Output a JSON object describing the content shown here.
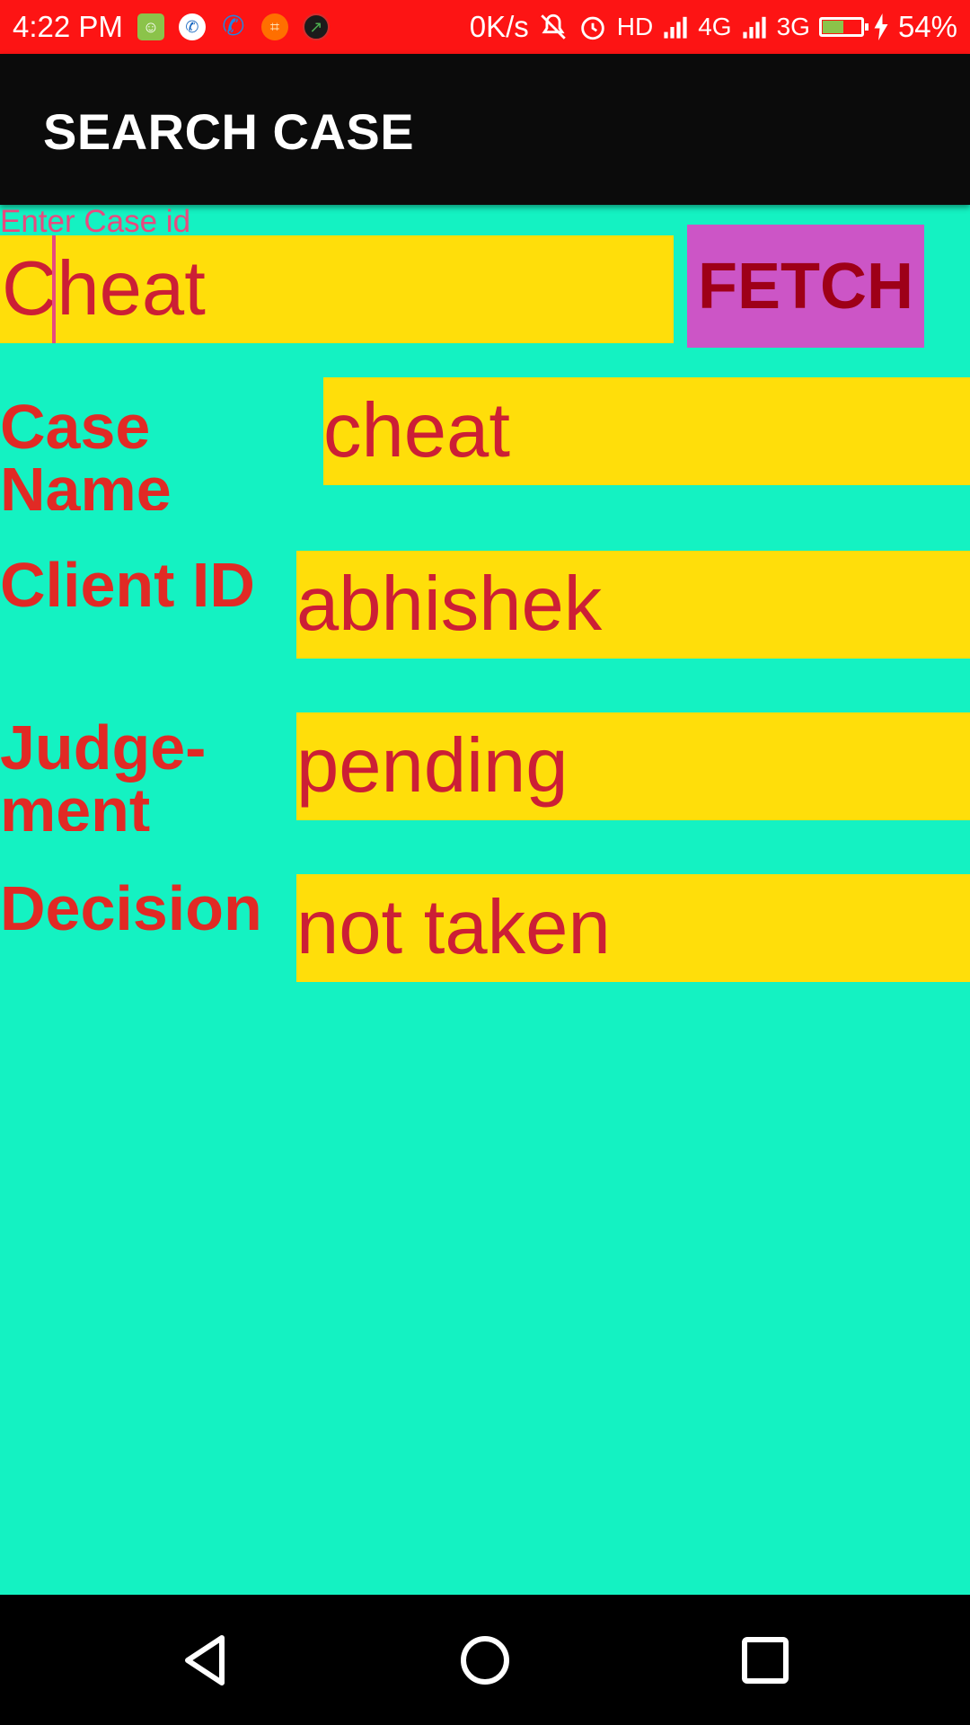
{
  "status_bar": {
    "time": "4:22 PM",
    "net_speed": "0K/s",
    "hd": "HD",
    "net1": "4G",
    "net2": "3G",
    "battery_pct": "54%",
    "battery_level": 0.54,
    "icons": [
      "message-icon",
      "call-icon",
      "phone-icon",
      "screenshot-icon",
      "recorder-icon",
      "mute-icon",
      "alarm-icon",
      "signal-icon",
      "charging-icon"
    ]
  },
  "app_bar": {
    "title": "SEARCH CASE"
  },
  "search": {
    "label": "Enter Case id",
    "value": "Cheat",
    "fetch_label": "FETCH"
  },
  "fields": [
    {
      "label": "Case Name",
      "value": "cheat"
    },
    {
      "label": "Client ID",
      "value": "abhishek"
    },
    {
      "label": "Judge-ment",
      "value": "pending"
    },
    {
      "label": "Decision",
      "value": "not taken"
    }
  ],
  "colors": {
    "background": "#14f2c2",
    "status_bar": "#fd1414",
    "app_bar": "#0b0b0b",
    "field": "#ffde0a",
    "field_text": "#cc1f35",
    "label_text": "#e12a25",
    "fetch_button": "#cc55c6",
    "hint": "#e84a7f"
  },
  "nav": {
    "icons": [
      "back-icon",
      "home-icon",
      "recents-icon"
    ]
  }
}
